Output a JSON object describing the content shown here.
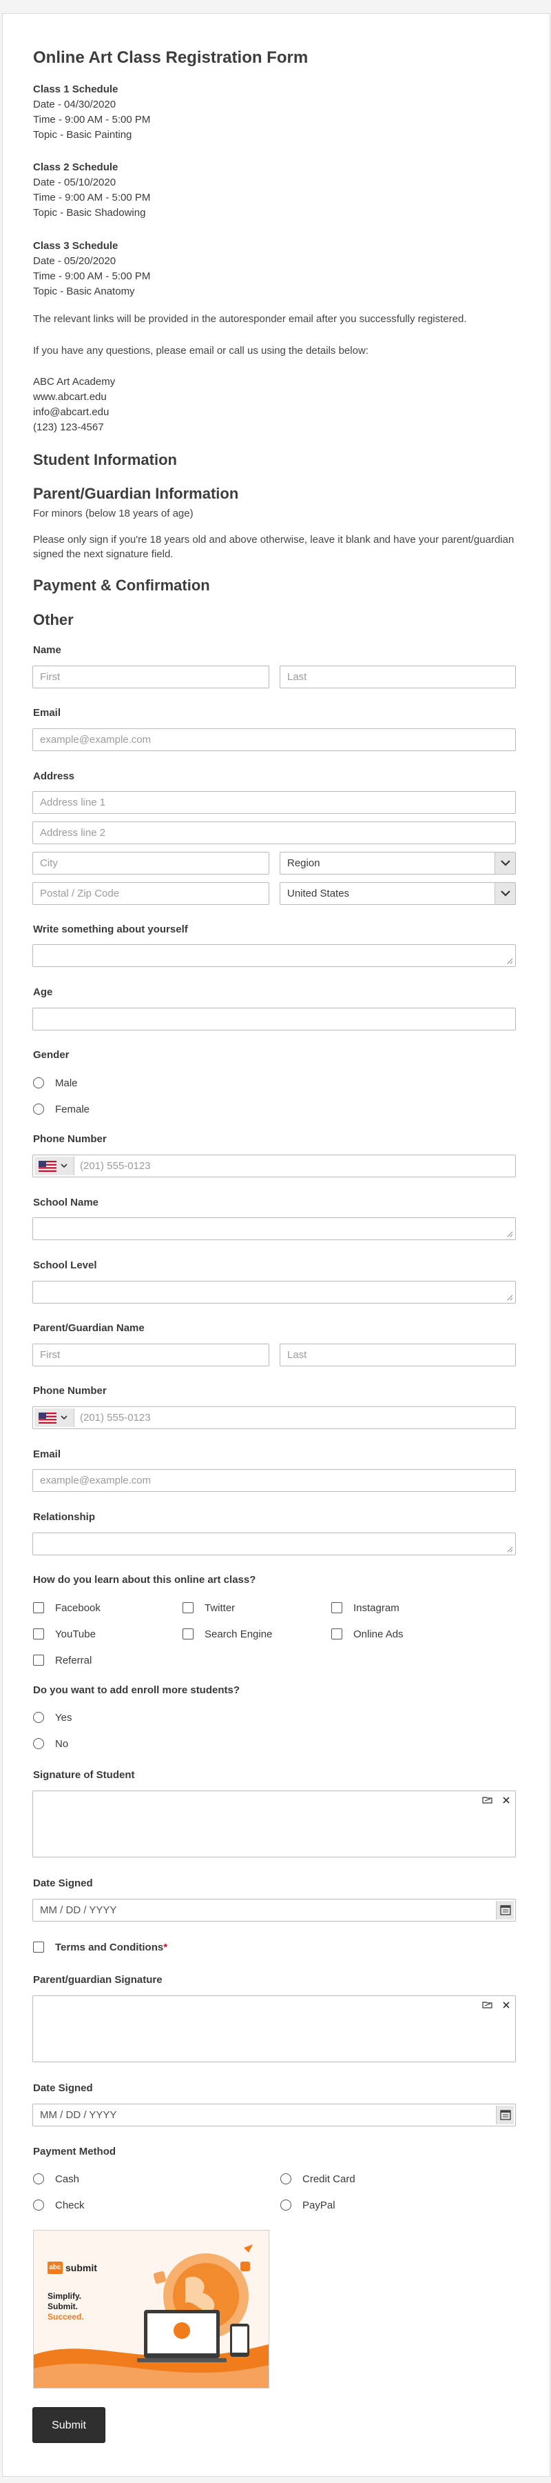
{
  "form": {
    "title": "Online Art Class Registration Form",
    "schedules": [
      {
        "heading": "Class 1 Schedule",
        "date": "Date - 04/30/2020",
        "time": "Time - 9:00 AM - 5:00 PM",
        "topic": "Topic - Basic Painting"
      },
      {
        "heading": "Class 2 Schedule",
        "date": "Date - 05/10/2020",
        "time": "Time - 9:00 AM - 5:00 PM",
        "topic": "Topic - Basic Shadowing"
      },
      {
        "heading": "Class 3 Schedule",
        "date": "Date - 05/20/2020",
        "time": "Time - 9:00 AM - 5:00 PM",
        "topic": "Topic - Basic Anatomy"
      }
    ],
    "links_note": "The relevant links will be provided in the autoresponder email after you successfully registered.",
    "questions_note": "If you have any questions, please email or call us using the details below:",
    "contact": {
      "name": "ABC Art Academy",
      "website": "www.abcart.edu",
      "email": "info@abcart.edu",
      "phone": "(123) 123-4567"
    }
  },
  "sections": {
    "student_info": "Student Information",
    "parent_info": "Parent/Guardian Information",
    "parent_sub": "For minors (below 18 years of age)",
    "parent_note": "Please only sign if you're 18 years old and above otherwise, leave it blank and have your parent/guardian signed the next signature field.",
    "payment": "Payment & Confirmation",
    "other": "Other"
  },
  "fields": {
    "name_label": "Name",
    "first_ph": "First",
    "last_ph": "Last",
    "email_label": "Email",
    "email_ph": "example@example.com",
    "address_label": "Address",
    "address1_ph": "Address line 1",
    "address2_ph": "Address line 2",
    "city_ph": "City",
    "region_value": "Region",
    "postal_ph": "Postal / Zip Code",
    "country_value": "United States",
    "about_label": "Write something about yourself",
    "age_label": "Age",
    "gender_label": "Gender",
    "gender_options": [
      "Male",
      "Female"
    ],
    "phone_label": "Phone Number",
    "phone_ph": "(201) 555-0123",
    "school_name_label": "School Name",
    "school_level_label": "School Level",
    "guardian_name_label": "Parent/Guardian Name",
    "guardian_first_ph": "First",
    "guardian_last_ph": "Last",
    "guardian_phone_label": "Phone Number",
    "guardian_phone_ph": "(201) 555-0123",
    "guardian_email_label": "Email",
    "guardian_email_ph": "example@example.com",
    "relationship_label": "Relationship",
    "learn_label": "How do you learn about this online art class?",
    "learn_options": [
      "Facebook",
      "Twitter",
      "Instagram",
      "YouTube",
      "Search Engine",
      "Online Ads",
      "Referral"
    ],
    "enroll_label": "Do you want to add enroll more students?",
    "enroll_options": [
      "Yes",
      "No"
    ],
    "student_sig_label": "Signature of Student",
    "date_signed_label": "Date Signed",
    "date_ph": "MM / DD / YYYY",
    "terms_label": "Terms and Conditions",
    "terms_required": "*",
    "guardian_sig_label": "Parent/guardian Signature",
    "date_signed2_label": "Date Signed",
    "date2_ph": "MM / DD / YYYY",
    "payment_label": "Payment Method",
    "payment_options": [
      "Cash",
      "Credit Card",
      "Check",
      "PayPal"
    ]
  },
  "promo": {
    "brand_badge": "abc",
    "brand_name": "submit",
    "line1": "Simplify.",
    "line2": "Submit.",
    "line3": "Succeed."
  },
  "submit_label": "Submit",
  "colors": {
    "accent": "#f07c1b",
    "button": "#2f2f2f",
    "required": "#c8102e"
  }
}
